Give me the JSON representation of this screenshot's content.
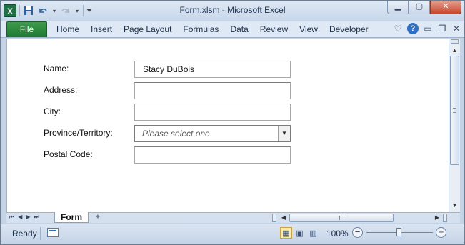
{
  "window": {
    "title": "Form.xlsm  -  Microsoft Excel"
  },
  "ribbon": {
    "file_label": "File",
    "tabs": [
      "Home",
      "Insert",
      "Page Layout",
      "Formulas",
      "Data",
      "Review",
      "View",
      "Developer"
    ]
  },
  "form": {
    "name": {
      "label": "Name:",
      "value": "Stacy DuBois"
    },
    "address": {
      "label": "Address:",
      "value": ""
    },
    "city": {
      "label": "City:",
      "value": ""
    },
    "province": {
      "label": "Province/Territory:",
      "placeholder": "Please select one"
    },
    "postal": {
      "label": "Postal Code:",
      "value": ""
    }
  },
  "sheet_tabs": {
    "active": "Form"
  },
  "status": {
    "ready": "Ready",
    "zoom": "100%"
  }
}
